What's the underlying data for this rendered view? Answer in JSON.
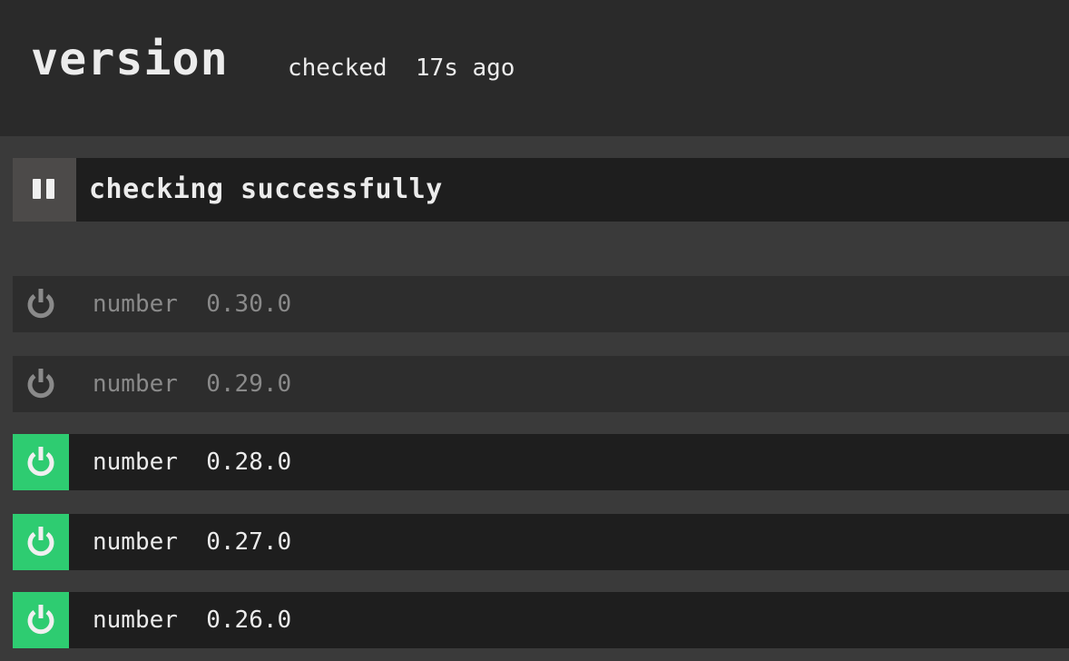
{
  "header": {
    "title": "version",
    "checked_label": "checked",
    "checked_age": "17s ago"
  },
  "status": {
    "text": "checking successfully",
    "pause_icon": "pause-icon"
  },
  "versions": [
    {
      "key": "number",
      "value": "0.30.0",
      "enabled": false
    },
    {
      "key": "number",
      "value": "0.29.0",
      "enabled": false
    },
    {
      "key": "number",
      "value": "0.28.0",
      "enabled": true
    },
    {
      "key": "number",
      "value": "0.27.0",
      "enabled": true
    },
    {
      "key": "number",
      "value": "0.26.0",
      "enabled": true
    }
  ],
  "colors": {
    "enabled_accent": "#2ecc71",
    "disabled_icon": "#8a8a8a"
  }
}
